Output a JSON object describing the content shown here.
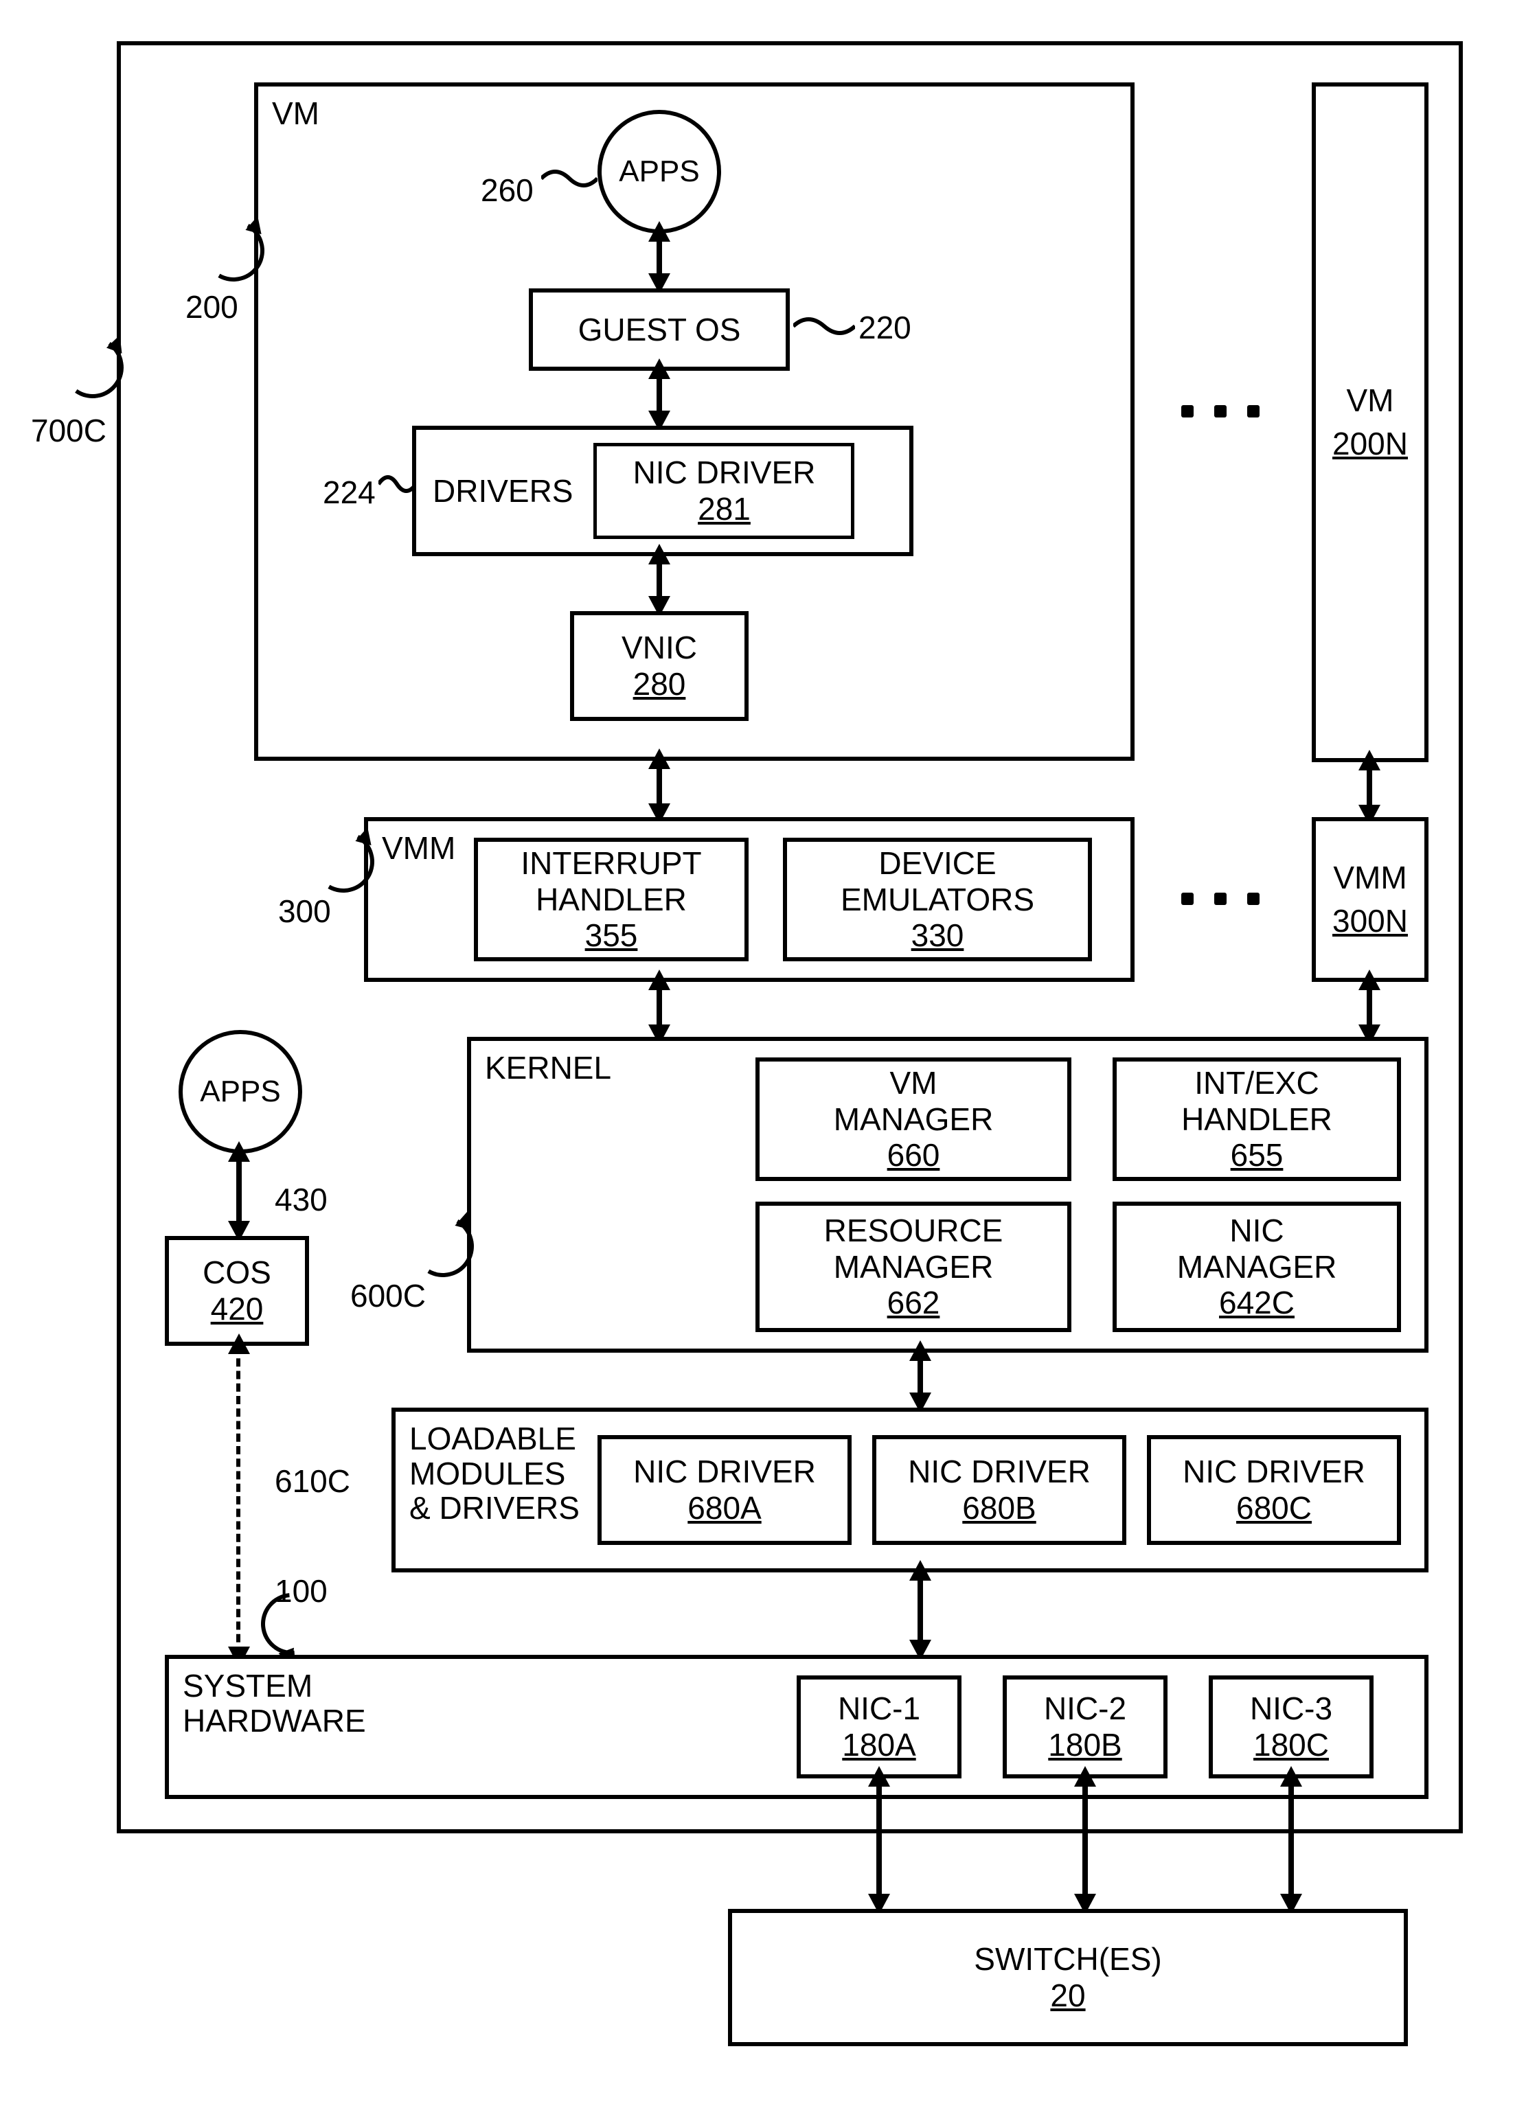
{
  "outer": {
    "ref": "700C"
  },
  "vm": {
    "title": "VM",
    "ref": "200",
    "apps": {
      "label": "APPS",
      "ref": "260"
    },
    "guest_os": {
      "label": "GUEST OS",
      "ref": "220"
    },
    "drivers": {
      "label": "DRIVERS",
      "ref": "224"
    },
    "nic_driver": {
      "label": "NIC DRIVER",
      "num": "281"
    },
    "vnic": {
      "label": "VNIC",
      "num": "280"
    }
  },
  "vm_n": {
    "title": "VM",
    "num": "200N"
  },
  "vmm": {
    "title": "VMM",
    "ref": "300",
    "interrupt": {
      "label": "INTERRUPT HANDLER",
      "num": "355"
    },
    "device_em": {
      "label": "DEVICE EMULATORS",
      "num": "330"
    }
  },
  "vmm_n": {
    "title": "VMM",
    "num": "300N"
  },
  "cos": {
    "label": "COS",
    "num": "420"
  },
  "cos_apps": {
    "label": "APPS",
    "ref": "430"
  },
  "kernel": {
    "title": "KERNEL",
    "ref": "600C",
    "vm_mgr": {
      "label": "VM MANAGER",
      "num": "660"
    },
    "int_exc": {
      "label": "INT/EXC HANDLER",
      "num": "655"
    },
    "res_mgr": {
      "label": "RESOURCE MANAGER",
      "num": "662"
    },
    "nic_mgr": {
      "label": "NIC MANAGER",
      "num": "642C"
    }
  },
  "loadable": {
    "title": "LOADABLE MODULES & DRIVERS",
    "ref": "610C",
    "d1": {
      "label": "NIC DRIVER",
      "num": "680A"
    },
    "d2": {
      "label": "NIC DRIVER",
      "num": "680B"
    },
    "d3": {
      "label": "NIC DRIVER",
      "num": "680C"
    }
  },
  "hw": {
    "title": "SYSTEM HARDWARE",
    "ref": "100",
    "nic1": {
      "label": "NIC-1",
      "num": "180A"
    },
    "nic2": {
      "label": "NIC-2",
      "num": "180B"
    },
    "nic3": {
      "label": "NIC-3",
      "num": "180C"
    }
  },
  "switch": {
    "label": "SWITCH(ES)",
    "num": "20"
  }
}
